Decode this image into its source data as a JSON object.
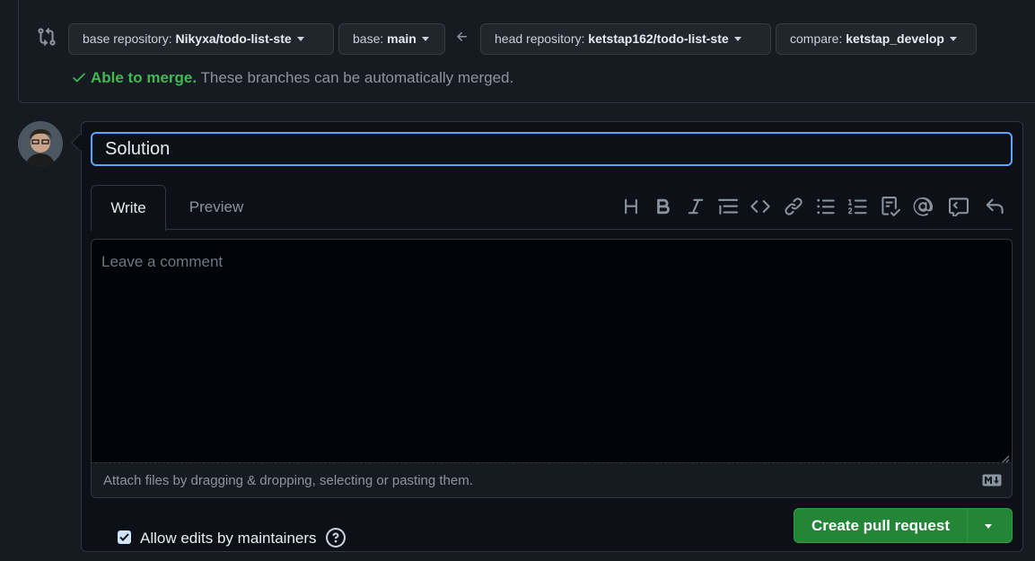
{
  "compare": {
    "base_repo_label": "base repository:",
    "base_repo_value": "Nikyxa/todo-list-ste",
    "base_label": "base:",
    "base_value": "main",
    "head_repo_label": "head repository:",
    "head_repo_value": "ketstap162/todo-list-ste",
    "compare_label": "compare:",
    "compare_value": "ketstap_develop",
    "merge_ok": "Able to merge.",
    "merge_rest": "These branches can be automatically merged."
  },
  "form": {
    "title_value": "Solution",
    "tabs": [
      {
        "label": "Write"
      },
      {
        "label": "Preview"
      }
    ],
    "toolbar_icons": [
      "heading-icon",
      "bold-icon",
      "italic-icon",
      "quote-icon",
      "code-icon",
      "link-icon",
      "unordered-list-icon",
      "ordered-list-icon",
      "task-list-icon",
      "mention-icon",
      "reference-icon",
      "reply-icon"
    ],
    "comment_placeholder": "Leave a comment",
    "attach_text": "Attach files by dragging & dropping, selecting or pasting them.",
    "allow_edits_label": "Allow edits by maintainers",
    "allow_edits_checked": true,
    "create_button_label": "Create pull request"
  },
  "colors": {
    "accent": "#58a6ff",
    "success": "#3fb950",
    "primary_button": "#238636"
  }
}
